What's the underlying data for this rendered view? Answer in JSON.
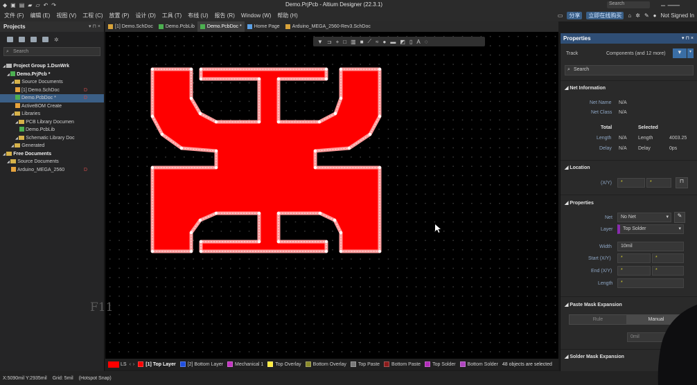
{
  "title_bar": {
    "window_title": "Demo.PrjPcb - Altium Designer (22.3.1)",
    "search_placeholder": "Search",
    "controls": "–  ⸺"
  },
  "menu": {
    "items": [
      "文件 (F)",
      "编辑 (E)",
      "视图 (V)",
      "工程 (C)",
      "放置 (P)",
      "设计 (D)",
      "工具 (T)",
      "布线 (U)",
      "报告 (R)",
      "Window (W)",
      "帮助 (H)"
    ],
    "share": "分享",
    "buy": "立即在线购买",
    "user": "Not Signed In"
  },
  "projects_panel": {
    "title": "Projects",
    "controls": "▾ ⊓ ×",
    "search_placeholder": "Search",
    "tree": [
      {
        "label": "Project Group 1.DsnWrk",
        "bold": true,
        "indent": 0
      },
      {
        "label": "Demo.PrjPcb *",
        "bold": true,
        "indent": 1,
        "mark": ""
      },
      {
        "label": "Source Documents",
        "indent": 2,
        "icon": "folder"
      },
      {
        "label": "[1] Demo.SchDoc",
        "indent": 3,
        "icon": "sch",
        "mark": "D"
      },
      {
        "label": "Demo.PcbDoc *",
        "indent": 3,
        "icon": "pcb",
        "mark": "D",
        "selected": true
      },
      {
        "label": "ActiveBOM  Create",
        "indent": 3,
        "icon": "sch"
      },
      {
        "label": "Libraries",
        "indent": 2,
        "icon": "folder"
      },
      {
        "label": "PCB Library Documen",
        "indent": 3,
        "icon": "folder"
      },
      {
        "label": "Demo.PcbLib",
        "indent": 4,
        "icon": "pcb"
      },
      {
        "label": "Schematic Library Doc",
        "indent": 3,
        "icon": "folder"
      },
      {
        "label": "Generated",
        "indent": 2,
        "icon": "folder"
      },
      {
        "label": "Free Documents",
        "bold": true,
        "indent": 0,
        "icon": "folder"
      },
      {
        "label": "Source Documents",
        "indent": 1,
        "icon": "folder"
      },
      {
        "label": "Arduino_MEGA_2560",
        "indent": 2,
        "icon": "sch",
        "mark": "D"
      }
    ]
  },
  "tabs": [
    {
      "label": "[1] Demo.SchDoc",
      "color": "#d8a33a"
    },
    {
      "label": "Demo.PcbLib",
      "color": "#4caf50"
    },
    {
      "label": "Demo.PcbDoc *",
      "color": "#4caf50",
      "active": true
    },
    {
      "label": "Home Page",
      "color": "#5aa0e6"
    },
    {
      "label": "Arduino_MEGA_2560-Rev3.SchDoc",
      "color": "#d8a33a"
    }
  ],
  "canvas": {
    "overlay_text": "F11",
    "copper_color": "#ff0000",
    "select_outline": "#ffffff"
  },
  "layers": {
    "current": "LS",
    "items": [
      {
        "label": "[1] Top Layer",
        "color": "#ff0000",
        "active": true
      },
      {
        "label": "[2] Bottom Layer",
        "color": "#1f4fe0"
      },
      {
        "label": "Mechanical 1",
        "color": "#c233c2"
      },
      {
        "label": "Top Overlay",
        "color": "#ffeb3b"
      },
      {
        "label": "Bottom Overlay",
        "color": "#8a8a2a"
      },
      {
        "label": "Top Paste",
        "color": "#7a7a7a"
      },
      {
        "label": "Bottom Paste",
        "color": "#8a1a1a"
      },
      {
        "label": "Top Solder",
        "color": "#b02ab8"
      },
      {
        "label": "Bottom Solder",
        "color": "#b045c0"
      }
    ],
    "selection_info": "48 objects are selected"
  },
  "status": {
    "coords": "X:5090mil Y:2935mil",
    "grid": "Grid: 5mil",
    "snap": "(Hotspot Snap)"
  },
  "properties": {
    "title": "Properties",
    "controls": "▾ ⊓ ×",
    "type_label": "Track",
    "filter": "Components (and 12 more)",
    "search_placeholder": "Search",
    "net_info": {
      "section": "Net Information",
      "net_name_label": "Net Name",
      "net_name": "N/A",
      "net_class_label": "Net Class",
      "net_class": "N/A",
      "total": "Total",
      "selected": "Selected",
      "length_label": "Length",
      "length_total": "N/A",
      "length_sel_label": "Length",
      "length_sel": "4003.25",
      "delay_label": "Delay",
      "delay_total": "N/A",
      "delay_sel_label": "Delay",
      "delay_sel": "0ps"
    },
    "location": {
      "section": "Location",
      "xy_label": "(X/Y)",
      "x": "*",
      "y": "*"
    },
    "props": {
      "section": "Properties",
      "net_label": "Net",
      "net": "No Net",
      "layer_label": "Layer",
      "layer": "Top Solder",
      "width_label": "Width",
      "width": "10mil",
      "start_label": "Start (X/Y)",
      "start_x": "*",
      "start_y": "*",
      "end_label": "End (X/Y)",
      "end_x": "*",
      "end_y": "*",
      "length_label": "Length",
      "length": "*"
    },
    "paste": {
      "section": "Paste Mask Expansion",
      "rule": "Rule",
      "manual": "Manual",
      "value": "0mil"
    },
    "solder": {
      "section": "Solder Mask Expansion"
    }
  }
}
